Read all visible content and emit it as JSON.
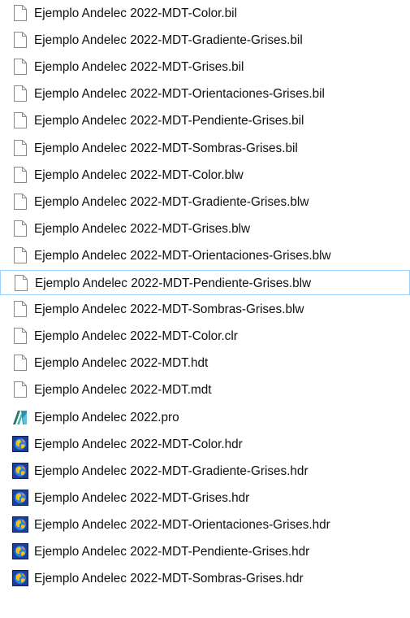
{
  "files": [
    {
      "name": "Ejemplo Andelec 2022-MDT-Color.bil",
      "icon": "blank-document-icon"
    },
    {
      "name": "Ejemplo Andelec 2022-MDT-Gradiente-Grises.bil",
      "icon": "blank-document-icon"
    },
    {
      "name": "Ejemplo Andelec 2022-MDT-Grises.bil",
      "icon": "blank-document-icon"
    },
    {
      "name": "Ejemplo Andelec 2022-MDT-Orientaciones-Grises.bil",
      "icon": "blank-document-icon"
    },
    {
      "name": "Ejemplo Andelec 2022-MDT-Pendiente-Grises.bil",
      "icon": "blank-document-icon"
    },
    {
      "name": "Ejemplo Andelec 2022-MDT-Sombras-Grises.bil",
      "icon": "blank-document-icon"
    },
    {
      "name": "Ejemplo Andelec 2022-MDT-Color.blw",
      "icon": "blank-document-icon"
    },
    {
      "name": "Ejemplo Andelec 2022-MDT-Gradiente-Grises.blw",
      "icon": "blank-document-icon"
    },
    {
      "name": "Ejemplo Andelec 2022-MDT-Grises.blw",
      "icon": "blank-document-icon"
    },
    {
      "name": "Ejemplo Andelec 2022-MDT-Orientaciones-Grises.blw",
      "icon": "blank-document-icon"
    },
    {
      "name": "Ejemplo Andelec 2022-MDT-Pendiente-Grises.blw",
      "icon": "blank-document-icon",
      "focused": true
    },
    {
      "name": "Ejemplo Andelec 2022-MDT-Sombras-Grises.blw",
      "icon": "blank-document-icon"
    },
    {
      "name": "Ejemplo Andelec 2022-MDT-Color.clr",
      "icon": "blank-document-icon"
    },
    {
      "name": "Ejemplo Andelec 2022-MDT.hdt",
      "icon": "blank-document-icon"
    },
    {
      "name": "Ejemplo Andelec 2022-MDT.mdt",
      "icon": "blank-document-icon"
    },
    {
      "name": "Ejemplo Andelec 2022.pro",
      "icon": "project-app-icon"
    },
    {
      "name": "Ejemplo Andelec 2022-MDT-Color.hdr",
      "icon": "globe-header-icon"
    },
    {
      "name": "Ejemplo Andelec 2022-MDT-Gradiente-Grises.hdr",
      "icon": "globe-header-icon"
    },
    {
      "name": "Ejemplo Andelec 2022-MDT-Grises.hdr",
      "icon": "globe-header-icon"
    },
    {
      "name": "Ejemplo Andelec 2022-MDT-Orientaciones-Grises.hdr",
      "icon": "globe-header-icon"
    },
    {
      "name": "Ejemplo Andelec 2022-MDT-Pendiente-Grises.hdr",
      "icon": "globe-header-icon"
    },
    {
      "name": "Ejemplo Andelec 2022-MDT-Sombras-Grises.hdr",
      "icon": "globe-header-icon"
    }
  ],
  "colors": {
    "focus_border": "#99d1ff",
    "text": "#101010"
  }
}
